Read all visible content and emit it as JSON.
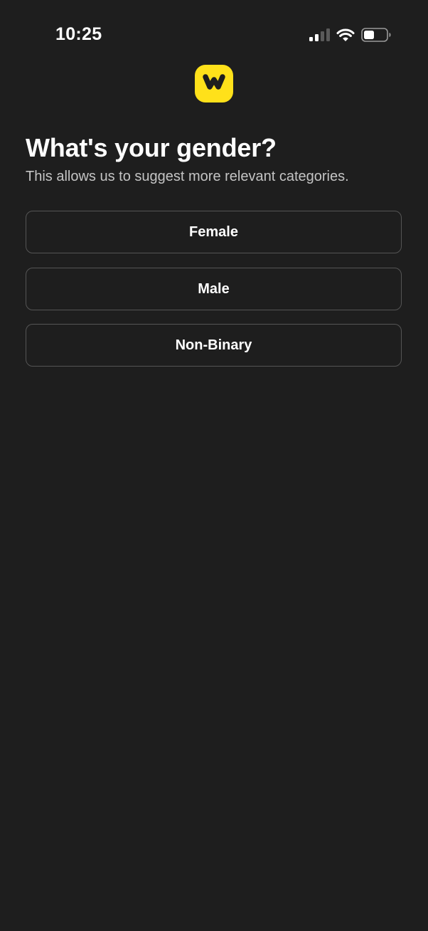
{
  "status_bar": {
    "time": "10:25",
    "icons": [
      "cellular-signal-icon",
      "wifi-icon",
      "battery-icon"
    ]
  },
  "logo": {
    "icon": "w-logo-icon",
    "background_color": "#ffe11a"
  },
  "header": {
    "title": "What's your gender?",
    "subtitle": "This allows us to suggest more relevant categories."
  },
  "options": [
    {
      "label": "Female"
    },
    {
      "label": "Male"
    },
    {
      "label": "Non-Binary"
    }
  ],
  "colors": {
    "background": "#1e1e1e",
    "text": "#ffffff",
    "subtitle": "#c4c4c4",
    "button_border": "#555555",
    "accent": "#ffe11a"
  }
}
